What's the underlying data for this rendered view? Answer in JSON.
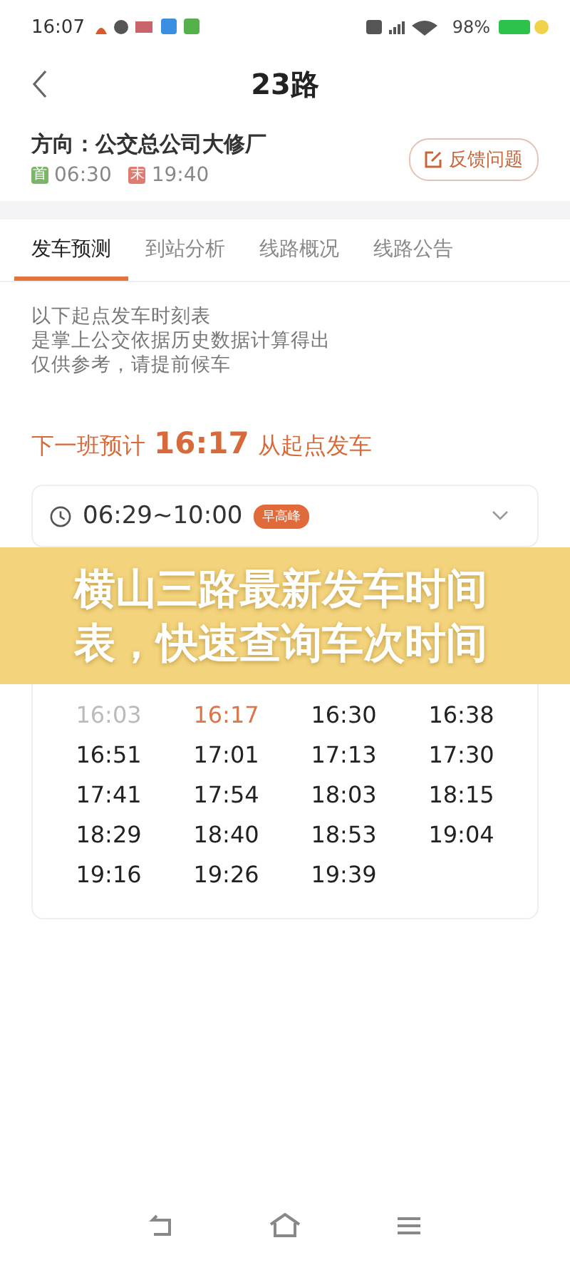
{
  "status_bar": {
    "time": "16:07",
    "battery": "98%"
  },
  "header": {
    "title": "23路"
  },
  "route": {
    "direction": "方向：公交总公司大修厂",
    "first_label": "首",
    "first_time": "06:30",
    "last_label": "末",
    "last_time": "19:40",
    "feedback": "反馈问题"
  },
  "tabs": [
    {
      "label": "发车预测",
      "selected": true
    },
    {
      "label": "到站分析",
      "selected": false
    },
    {
      "label": "线路概况",
      "selected": false
    },
    {
      "label": "线路公告",
      "selected": false
    }
  ],
  "notice": [
    "以下起点发车时刻表",
    "是掌上公交依据历史数据计算得出",
    "仅供参考，请提前候车"
  ],
  "next_bus": {
    "prefix": "下一班预计",
    "time": "16:17",
    "suffix": "从起点发车"
  },
  "periods": [
    {
      "time": "06:29~10:00",
      "tag": "早高峰",
      "expanded": false
    }
  ],
  "banner": {
    "text": "横山三路最新发车时间表，快速查询车次时间"
  },
  "timetable": [
    {
      "time": "16:03",
      "kind": "past"
    },
    {
      "time": "16:17",
      "kind": "next"
    },
    {
      "time": "16:30",
      "kind": "upcoming"
    },
    {
      "time": "16:38",
      "kind": "upcoming"
    },
    {
      "time": "16:51",
      "kind": "upcoming"
    },
    {
      "time": "17:01",
      "kind": "upcoming"
    },
    {
      "time": "17:13",
      "kind": "upcoming"
    },
    {
      "time": "17:30",
      "kind": "upcoming"
    },
    {
      "time": "17:41",
      "kind": "upcoming"
    },
    {
      "time": "17:54",
      "kind": "upcoming"
    },
    {
      "time": "18:03",
      "kind": "upcoming"
    },
    {
      "time": "18:15",
      "kind": "upcoming"
    },
    {
      "time": "18:29",
      "kind": "upcoming"
    },
    {
      "time": "18:40",
      "kind": "upcoming"
    },
    {
      "time": "18:53",
      "kind": "upcoming"
    },
    {
      "time": "19:04",
      "kind": "upcoming"
    },
    {
      "time": "19:16",
      "kind": "upcoming"
    },
    {
      "time": "19:26",
      "kind": "upcoming"
    },
    {
      "time": "19:39",
      "kind": "upcoming"
    }
  ]
}
